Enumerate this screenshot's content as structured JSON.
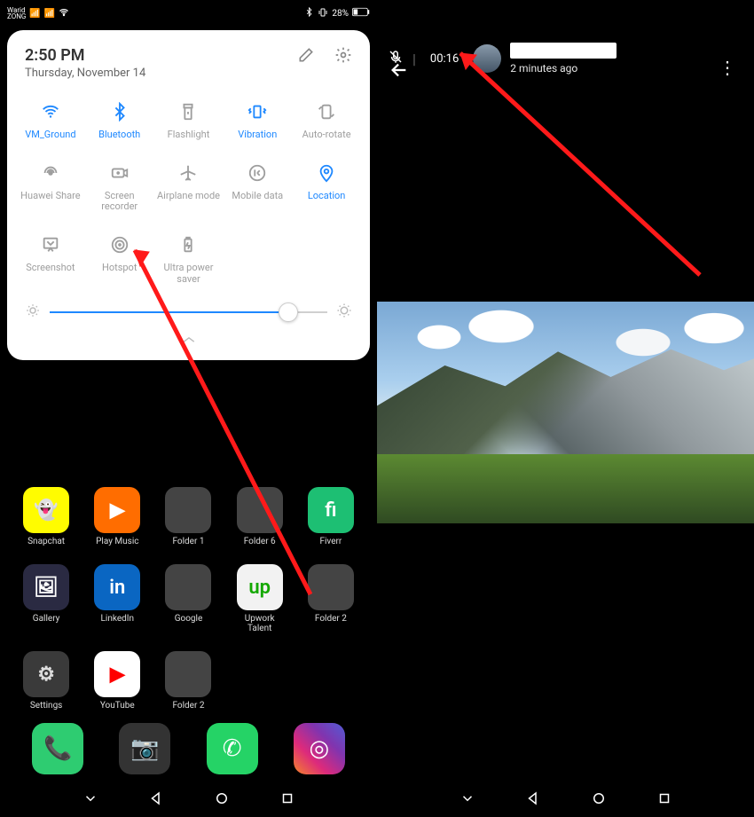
{
  "statusbar": {
    "carrier": "Warid\nZONG",
    "signal1": "4G",
    "signal2": "4G",
    "bt": "bluetooth-icon",
    "vib": "vibrate-icon",
    "battery_pct": "28%"
  },
  "panel": {
    "time": "2:50 PM",
    "date": "Thursday, November 14",
    "tiles": [
      {
        "id": "wifi",
        "name": "wifi-icon",
        "label": "VM_Ground",
        "on": true
      },
      {
        "id": "bt",
        "name": "bluetooth-icon",
        "label": "Bluetooth",
        "on": true
      },
      {
        "id": "flash",
        "name": "flashlight-icon",
        "label": "Flashlight",
        "on": false
      },
      {
        "id": "vib",
        "name": "vibration-icon",
        "label": "Vibration",
        "on": true
      },
      {
        "id": "rotate",
        "name": "autorotate-icon",
        "label": "Auto-rotate",
        "on": false
      },
      {
        "id": "hs",
        "name": "huaweishare-icon",
        "label": "Huawei Share",
        "on": false
      },
      {
        "id": "rec",
        "name": "screenrec-icon",
        "label": "Screen\nrecorder",
        "on": false
      },
      {
        "id": "air",
        "name": "airplane-icon",
        "label": "Airplane mode",
        "on": false
      },
      {
        "id": "data",
        "name": "mobiledata-icon",
        "label": "Mobile data",
        "on": false
      },
      {
        "id": "loc",
        "name": "location-icon",
        "label": "Location",
        "on": true
      },
      {
        "id": "shot",
        "name": "screenshot-icon",
        "label": "Screenshot",
        "on": false
      },
      {
        "id": "hot",
        "name": "hotspot-icon",
        "label": "Hotspot",
        "on": false
      },
      {
        "id": "ups",
        "name": "ultrapower-icon",
        "label": "Ultra power\nsaver",
        "on": false
      }
    ],
    "brightness_pct": 86
  },
  "home": {
    "rows": [
      [
        {
          "label": "Snapchat",
          "bg": "#fffc00",
          "fg": "#000",
          "glyph": "👻"
        },
        {
          "label": "Play Music",
          "bg": "#ff6d00",
          "fg": "#fff",
          "glyph": "▶"
        },
        {
          "label": "Folder 1",
          "bg": "#444",
          "fg": "#fff",
          "glyph": ""
        },
        {
          "label": "Folder 6",
          "bg": "#444",
          "fg": "#fff",
          "glyph": ""
        },
        {
          "label": "Fiverr",
          "bg": "#1dbf73",
          "fg": "#fff",
          "glyph": "fi"
        }
      ],
      [
        {
          "label": "Gallery",
          "bg": "#2a2a42",
          "fg": "#fff",
          "glyph": "🖼"
        },
        {
          "label": "LinkedIn",
          "bg": "#0a66c2",
          "fg": "#fff",
          "glyph": "in"
        },
        {
          "label": "Google",
          "bg": "#444",
          "fg": "#fff",
          "glyph": ""
        },
        {
          "label": "Upwork\nTalent",
          "bg": "#f2f2f2",
          "fg": "#14a800",
          "glyph": "up"
        },
        {
          "label": "Folder 2",
          "bg": "#444",
          "fg": "#fff",
          "glyph": ""
        }
      ],
      [
        {
          "label": "Settings",
          "bg": "#3a3a3a",
          "fg": "#ddd",
          "glyph": "⚙"
        },
        {
          "label": "YouTube",
          "bg": "#ffffff",
          "fg": "#ff0000",
          "glyph": "▶"
        },
        {
          "label": "Folder 2",
          "bg": "#444",
          "fg": "#fff",
          "glyph": ""
        },
        {
          "label": "",
          "bg": "transparent",
          "fg": "#fff",
          "glyph": ""
        },
        {
          "label": "",
          "bg": "transparent",
          "fg": "#fff",
          "glyph": ""
        }
      ]
    ],
    "dock": [
      {
        "name": "phone",
        "bg": "#2ecc71",
        "glyph": "📞"
      },
      {
        "name": "camera",
        "bg": "#333333",
        "glyph": "📷"
      },
      {
        "name": "whatsapp",
        "bg": "#25d366",
        "glyph": "✆"
      },
      {
        "name": "instagram",
        "bg": "linear-gradient(45deg,#f58529,#dd2a7b,#8134af,#515bd4)",
        "glyph": "◎"
      }
    ]
  },
  "right": {
    "rec_time": "00:16",
    "subtitle": "2 minutes ago"
  }
}
